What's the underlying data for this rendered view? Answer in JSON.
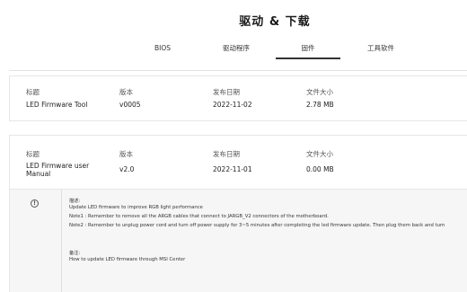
{
  "page": {
    "title": "驱动 & 下载"
  },
  "tabs": [
    {
      "label": "BIOS",
      "active": false
    },
    {
      "label": "驱动程序",
      "active": false
    },
    {
      "label": "固件",
      "active": true
    },
    {
      "label": "工具软件",
      "active": false
    }
  ],
  "columns": {
    "title": "标题",
    "version": "版本",
    "release_date": "发布日期",
    "file_size": "文件大小"
  },
  "items": [
    {
      "title": "LED Firmware Tool",
      "version": "v0005",
      "release_date": "2022-11-02",
      "file_size": "2.78 MB"
    },
    {
      "title_line1": "LED Firmware user",
      "title_line2": "Manual",
      "version": "v2.0",
      "release_date": "2022-11-01",
      "file_size": "0.00 MB"
    }
  ],
  "detail": {
    "icon": "info-icon",
    "description_label": "描述:",
    "description_lines": [
      "Update LED firmware to improve RGB light performance",
      "Note1 : Remember to remove all the ARGB cables that connect to JARGB_V2 connectors of the motherboard.",
      "Note2 : Remember to unplug power cord and turn off power supply for 3~5 minutes after completing the led firmware update. Then plug them back and turn"
    ],
    "notes_label": "备注:",
    "notes_text": "How to update LED firmware through MSI Center"
  }
}
